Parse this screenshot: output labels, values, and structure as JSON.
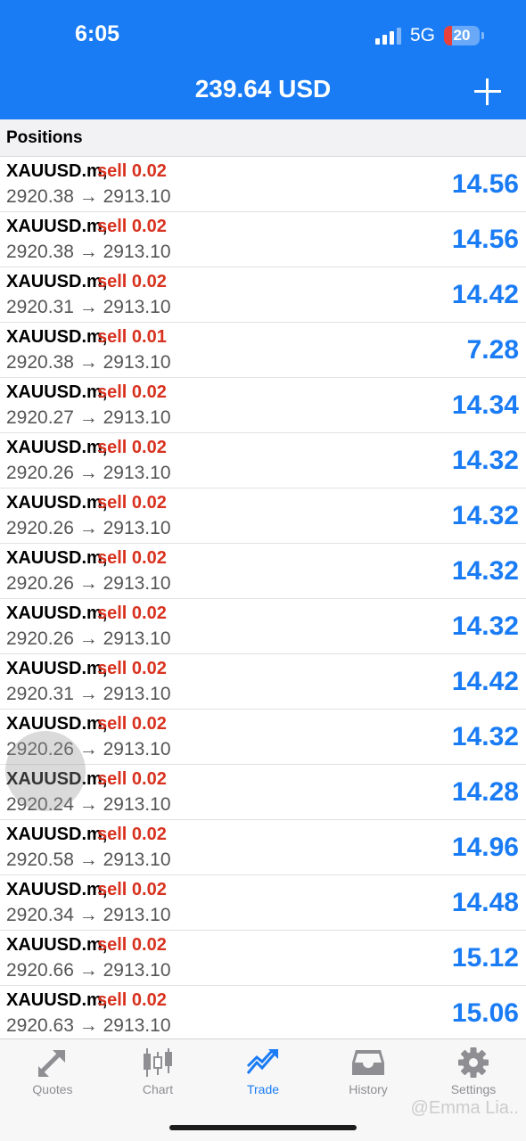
{
  "status_bar": {
    "time": "6:05",
    "network": "5G",
    "battery": "20"
  },
  "header": {
    "balance": "239.64 USD"
  },
  "section": {
    "label": "Positions"
  },
  "positions": [
    {
      "symbol": "XAUUSD.m,",
      "side": "sell 0.02",
      "open": "2920.38",
      "current": "2913.10",
      "profit": "14.56"
    },
    {
      "symbol": "XAUUSD.m,",
      "side": "sell 0.02",
      "open": "2920.38",
      "current": "2913.10",
      "profit": "14.56"
    },
    {
      "symbol": "XAUUSD.m,",
      "side": "sell 0.02",
      "open": "2920.31",
      "current": "2913.10",
      "profit": "14.42"
    },
    {
      "symbol": "XAUUSD.m,",
      "side": "sell 0.01",
      "open": "2920.38",
      "current": "2913.10",
      "profit": "7.28"
    },
    {
      "symbol": "XAUUSD.m,",
      "side": "sell 0.02",
      "open": "2920.27",
      "current": "2913.10",
      "profit": "14.34"
    },
    {
      "symbol": "XAUUSD.m,",
      "side": "sell 0.02",
      "open": "2920.26",
      "current": "2913.10",
      "profit": "14.32"
    },
    {
      "symbol": "XAUUSD.m,",
      "side": "sell 0.02",
      "open": "2920.26",
      "current": "2913.10",
      "profit": "14.32"
    },
    {
      "symbol": "XAUUSD.m,",
      "side": "sell 0.02",
      "open": "2920.26",
      "current": "2913.10",
      "profit": "14.32"
    },
    {
      "symbol": "XAUUSD.m,",
      "side": "sell 0.02",
      "open": "2920.26",
      "current": "2913.10",
      "profit": "14.32"
    },
    {
      "symbol": "XAUUSD.m,",
      "side": "sell 0.02",
      "open": "2920.31",
      "current": "2913.10",
      "profit": "14.42"
    },
    {
      "symbol": "XAUUSD.m,",
      "side": "sell 0.02",
      "open": "2920.26",
      "current": "2913.10",
      "profit": "14.32"
    },
    {
      "symbol": "XAUUSD.m,",
      "side": "sell 0.02",
      "open": "2920.24",
      "current": "2913.10",
      "profit": "14.28"
    },
    {
      "symbol": "XAUUSD.m,",
      "side": "sell 0.02",
      "open": "2920.58",
      "current": "2913.10",
      "profit": "14.96"
    },
    {
      "symbol": "XAUUSD.m,",
      "side": "sell 0.02",
      "open": "2920.34",
      "current": "2913.10",
      "profit": "14.48"
    },
    {
      "symbol": "XAUUSD.m,",
      "side": "sell 0.02",
      "open": "2920.66",
      "current": "2913.10",
      "profit": "15.12"
    },
    {
      "symbol": "XAUUSD.m,",
      "side": "sell 0.02",
      "open": "2920.63",
      "current": "2913.10",
      "profit": "15.06"
    }
  ],
  "tabs": [
    {
      "label": "Quotes",
      "icon": "quotes-arrows-icon",
      "active": false
    },
    {
      "label": "Chart",
      "icon": "candlestick-chart-icon",
      "active": false
    },
    {
      "label": "Trade",
      "icon": "trade-trend-icon",
      "active": true
    },
    {
      "label": "History",
      "icon": "history-inbox-icon",
      "active": false
    },
    {
      "label": "Settings",
      "icon": "gear-icon",
      "active": false
    }
  ],
  "watermark": "@Emma Lia..",
  "colors": {
    "accent": "#1a7cf5",
    "sell": "#d8321f",
    "inactive_tab": "#8e8e93"
  }
}
